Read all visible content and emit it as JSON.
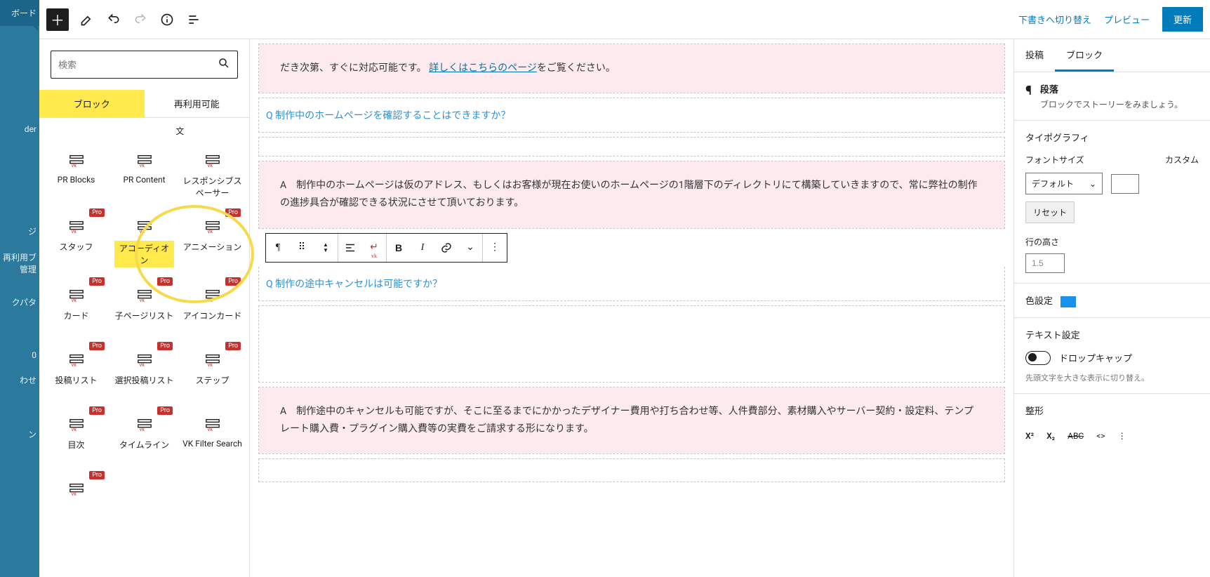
{
  "admin_sidebar": {
    "items": [
      "ボード",
      "der",
      "ジ",
      "再利用ブ管理",
      "クパタ",
      "0",
      "わせ",
      "ン"
    ]
  },
  "topbar": {
    "draft_switch": "下書きへ切り替え",
    "preview": "プレビュー",
    "update": "更新"
  },
  "inserter": {
    "search_placeholder": "検索",
    "tabs": {
      "blocks": "ブロック",
      "reusable": "再利用可能"
    },
    "partial_top": "文",
    "pro_label": "Pro",
    "blocks": [
      {
        "label": "PR Blocks",
        "pro": false
      },
      {
        "label": "PR Content",
        "pro": false
      },
      {
        "label": "レスポンシブスペーサー",
        "pro": false
      },
      {
        "label": "スタッフ",
        "pro": true
      },
      {
        "label": "アコーディオン",
        "pro": false,
        "highlight": true
      },
      {
        "label": "アニメーション",
        "pro": true
      },
      {
        "label": "カード",
        "pro": true
      },
      {
        "label": "子ページリスト",
        "pro": true
      },
      {
        "label": "アイコンカード",
        "pro": true
      },
      {
        "label": "投稿リスト",
        "pro": true
      },
      {
        "label": "選択投稿リスト",
        "pro": true
      },
      {
        "label": "ステップ",
        "pro": true
      },
      {
        "label": "目次",
        "pro": true
      },
      {
        "label": "タイムライン",
        "pro": true
      },
      {
        "label": "VK Filter Search",
        "pro": false
      },
      {
        "label": "",
        "pro": true
      }
    ]
  },
  "editor": {
    "a0_suffix": "だき次第、すぐに対応可能です。",
    "a0_link": "詳しくはこちらのページ",
    "a0_tail": "をご覧ください。",
    "q1_prefix": "Q ",
    "q1": "制作中のホームページを確認することはできますか？",
    "a1_prefix": "A　",
    "a1": "制作中のホームページは仮のアドレス、もしくはお客様が現在お使いのホームページの1階層下のディレクトリにて構築していきますので、常に弊社の制作の進捗具合が確認できる状況にさせて頂いております。",
    "q2_prefix": "Q ",
    "q2": "制作の途中キャンセルは可能ですか？",
    "a2_prefix": "A　",
    "a2": "制作途中のキャンセルも可能ですが、そこに至るまでにかかったデザイナー費用や打ち合わせ等、人件費部分、素材購入やサーバー契約・設定料、テンプレート購入費・プラグイン購入費等の実費をご請求する形になります。"
  },
  "rsidebar": {
    "tab_post": "投稿",
    "tab_block": "ブロック",
    "block_name": "段落",
    "block_desc": "ブロックでストーリーをみましょう。",
    "typography": "タイポグラフィ",
    "font_size": "フォントサイズ",
    "custom": "カスタム",
    "font_default": "デフォルト",
    "reset": "リセット",
    "line_height": "行の高さ",
    "line_height_value": "1.5",
    "color_settings": "色設定",
    "text_settings": "テキスト設定",
    "dropcap": "ドロップキャップ",
    "dropcap_help": "先頭文字を大きな表示に切り替え。",
    "format": "整形",
    "sup": "X²",
    "sub": "X₂",
    "strike": "ABC",
    "code": "<>",
    "more": "⋮"
  }
}
